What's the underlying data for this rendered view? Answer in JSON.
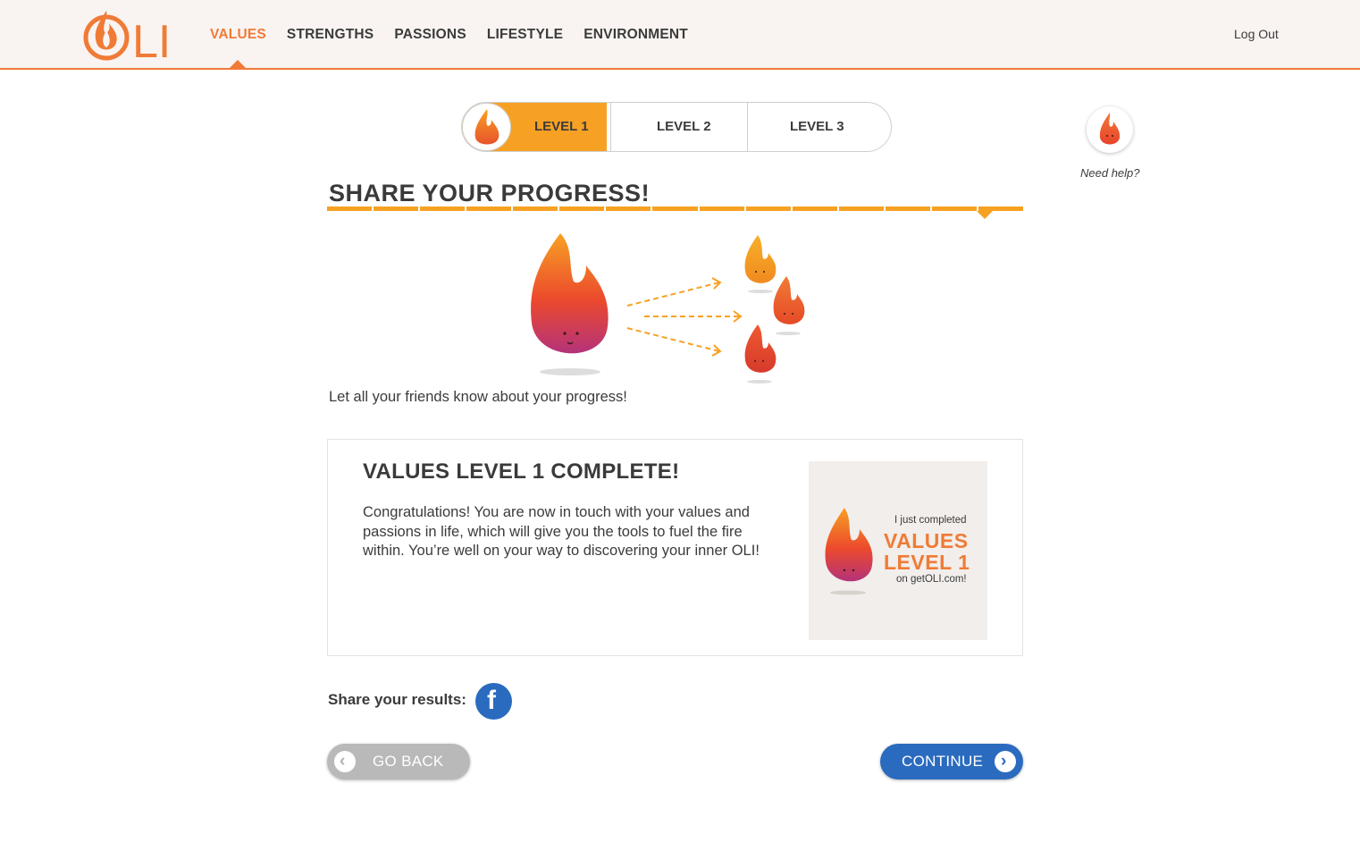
{
  "brand": {
    "logo_text": "OLI",
    "accent": "#f07b36",
    "accent_light": "#f7a124",
    "blue": "#2a6bbf"
  },
  "nav": {
    "items": [
      {
        "label": "VALUES",
        "active": true
      },
      {
        "label": "STRENGTHS",
        "active": false
      },
      {
        "label": "PASSIONS",
        "active": false
      },
      {
        "label": "LIFESTYLE",
        "active": false
      },
      {
        "label": "ENVIRONMENT",
        "active": false
      }
    ],
    "logout": "Log Out"
  },
  "levels": {
    "items": [
      "LEVEL 1",
      "LEVEL 2",
      "LEVEL 3"
    ],
    "active": "LEVEL 1"
  },
  "help": {
    "label": "Need help?",
    "icon": "flame-icon"
  },
  "page": {
    "title": "SHARE YOUR PROGRESS!",
    "progress": {
      "total_steps": 15,
      "current_step": 15
    },
    "intro": "Let all your friends know about your progress!"
  },
  "card": {
    "title": "VALUES LEVEL 1 COMPLETE!",
    "body": "Congratulations! You are now in touch with your values and passions in life, which will give you the tools to fuel the fire within. You’re well on your way to discovering your inner OLI!",
    "badge": {
      "line1": "I just completed",
      "line2": "VALUES",
      "line3": "LEVEL 1",
      "line4": "on getOLI.com!"
    }
  },
  "share": {
    "label": "Share your results:",
    "icon": "facebook-icon",
    "icon_glyph": "f"
  },
  "buttons": {
    "back": "GO BACK",
    "continue": "CONTINUE"
  }
}
